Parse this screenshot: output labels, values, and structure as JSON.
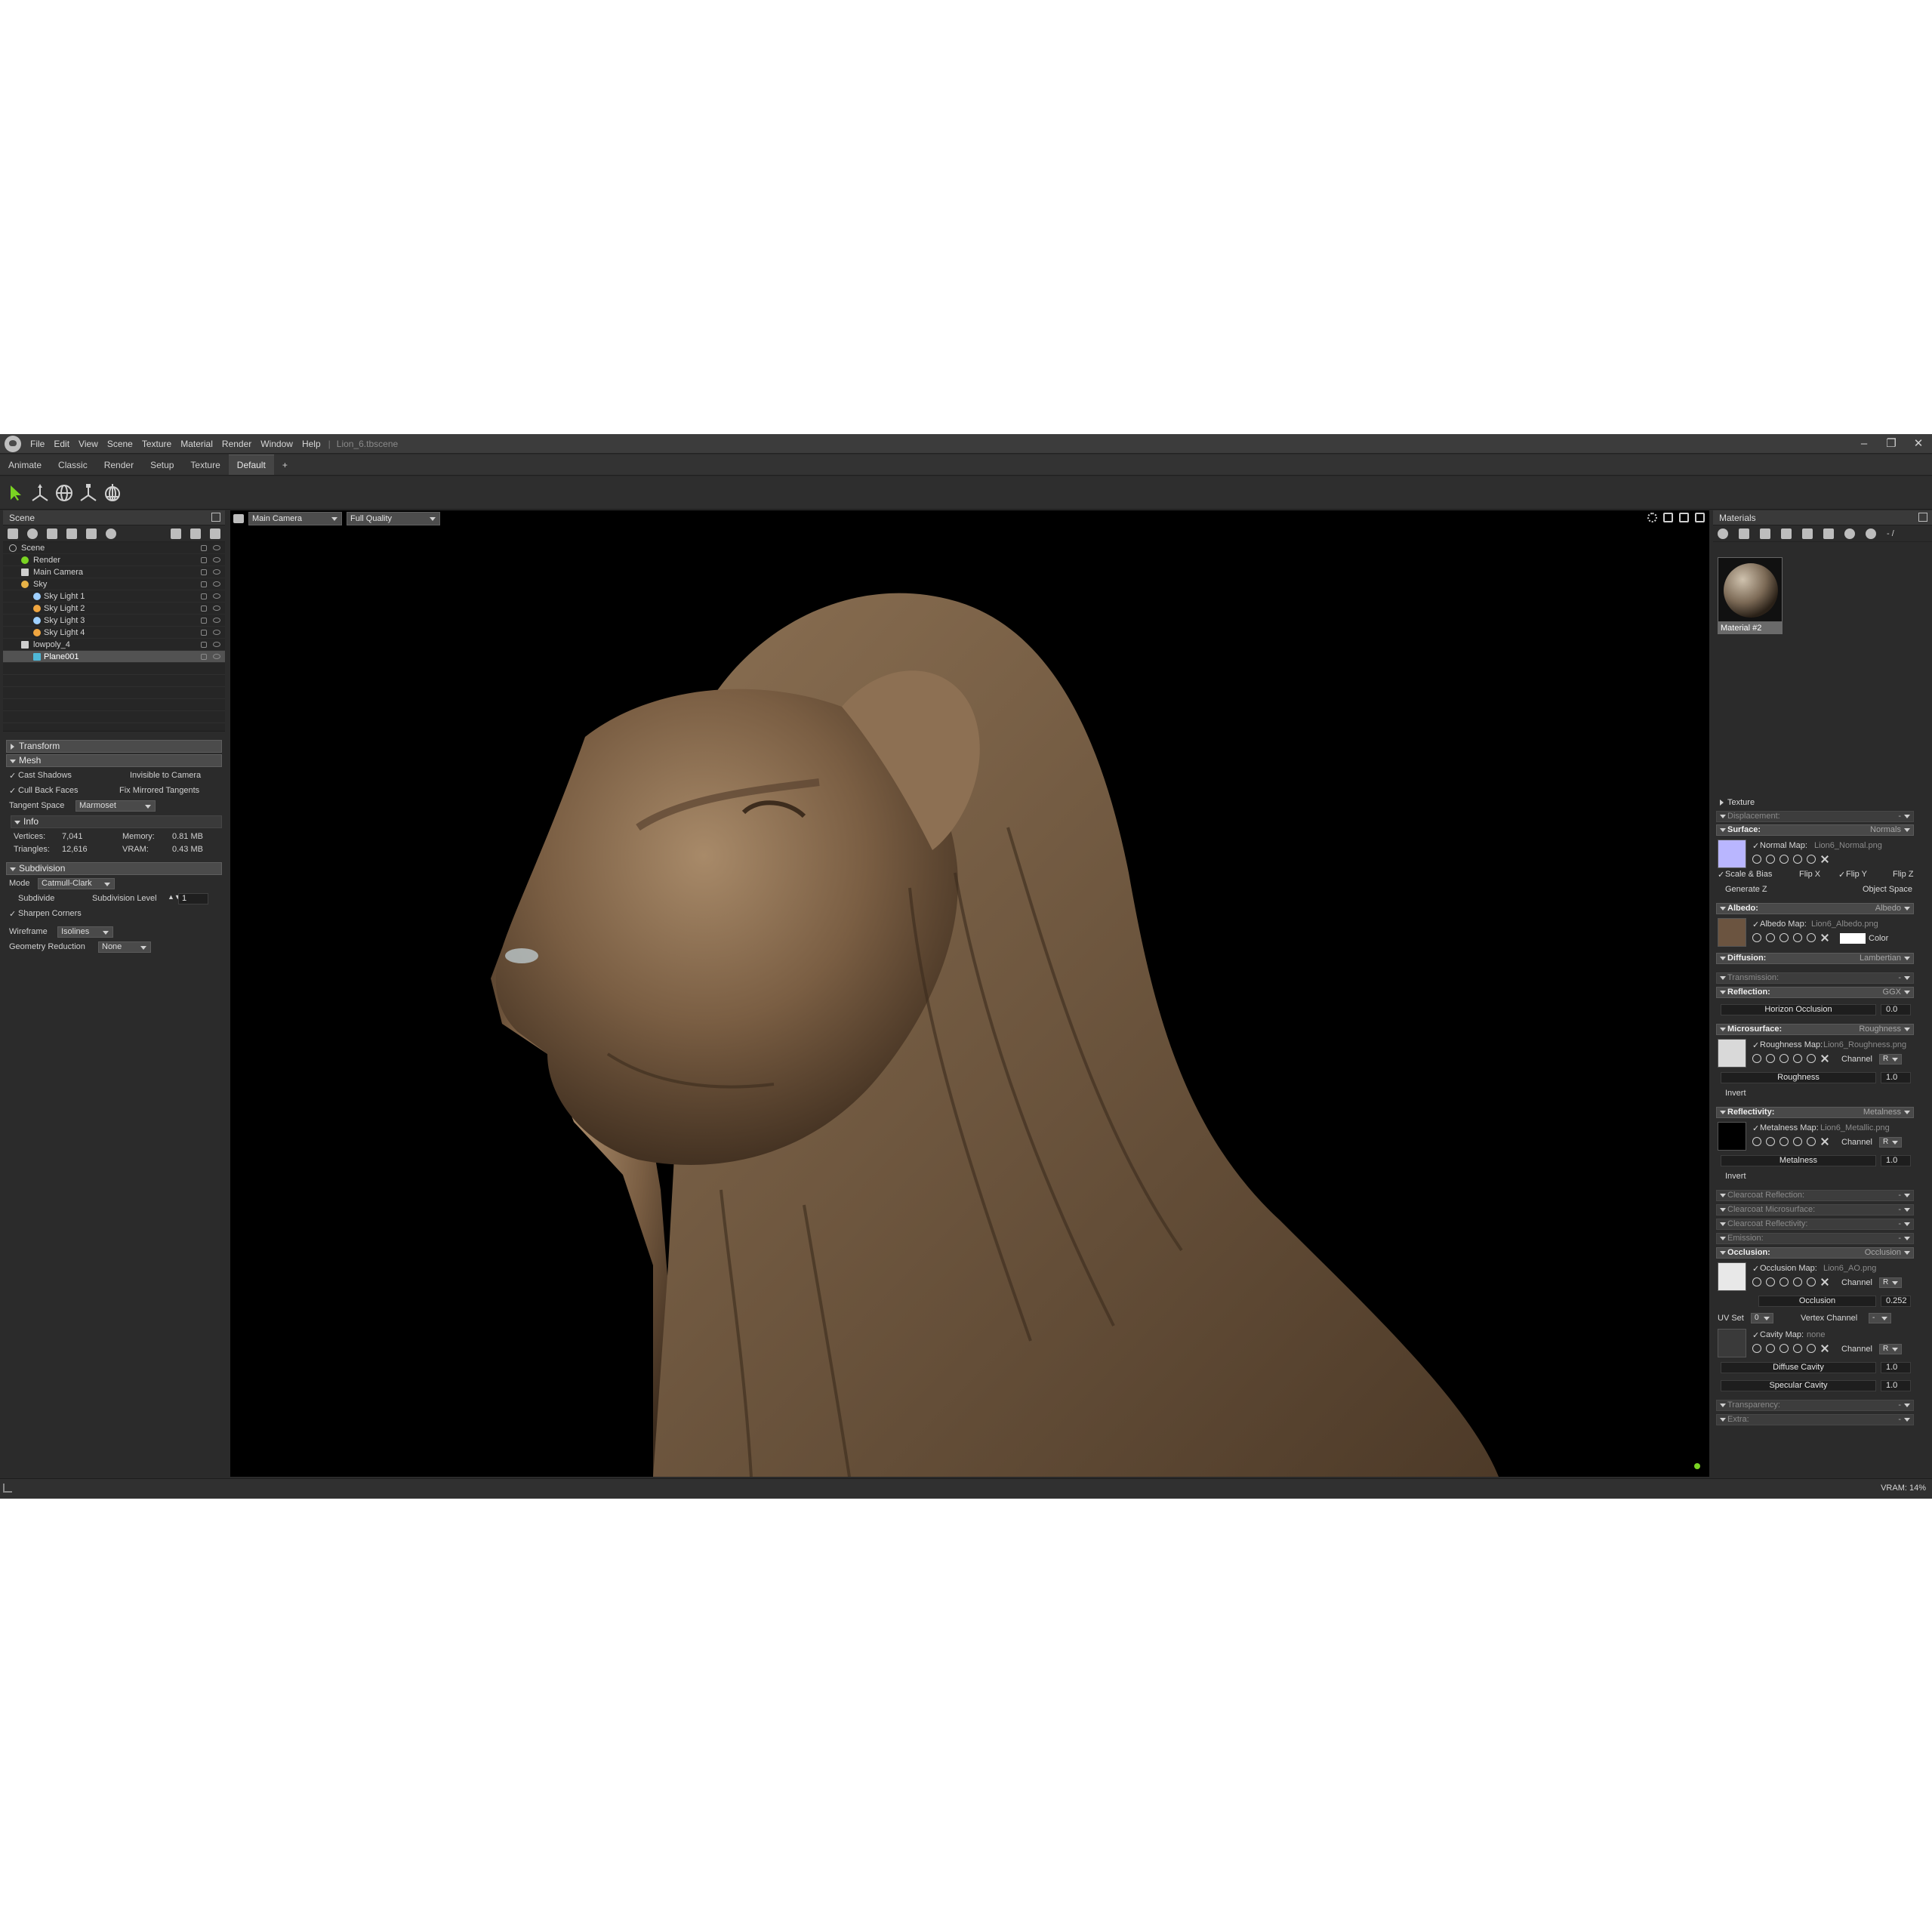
{
  "menu": {
    "items": [
      "File",
      "Edit",
      "View",
      "Scene",
      "Texture",
      "Material",
      "Render",
      "Window",
      "Help"
    ],
    "separator": "|",
    "document": "Lion_6.tbscene"
  },
  "workspace_tabs": [
    "Animate",
    "Classic",
    "Render",
    "Setup",
    "Texture",
    "Default",
    "+"
  ],
  "active_tab": "Default",
  "scene_panel": {
    "title": "Scene",
    "tree": [
      {
        "label": "Scene",
        "indent": 0
      },
      {
        "label": "Render",
        "indent": 1
      },
      {
        "label": "Main Camera",
        "indent": 1
      },
      {
        "label": "Sky",
        "indent": 1
      },
      {
        "label": "Sky Light 1",
        "indent": 2
      },
      {
        "label": "Sky Light 2",
        "indent": 2
      },
      {
        "label": "Sky Light 3",
        "indent": 2
      },
      {
        "label": "Sky Light 4",
        "indent": 2
      },
      {
        "label": "lowpoly_4",
        "indent": 1
      },
      {
        "label": "Plane001",
        "indent": 2
      }
    ],
    "selected": "Plane001"
  },
  "properties": {
    "transform": "Transform",
    "mesh": "Mesh",
    "cast_shadows": "Cast Shadows",
    "invisible_to_camera": "Invisible to Camera",
    "cull_back_faces": "Cull Back Faces",
    "fix_mirrored_tangents": "Fix Mirrored Tangents",
    "tangent_space_label": "Tangent Space",
    "tangent_space_value": "Marmoset",
    "info": "Info",
    "vertices_label": "Vertices:",
    "vertices_value": "7,041",
    "memory_label": "Memory:",
    "memory_value": "0.81 MB",
    "triangles_label": "Triangles:",
    "triangles_value": "12,616",
    "vram_label": "VRAM:",
    "vram_value": "0.43 MB",
    "subdivision": "Subdivision",
    "mode_label": "Mode",
    "mode_value": "Catmull-Clark",
    "subdivide": "Subdivide",
    "subdivision_level_label": "Subdivision Level",
    "subdivision_level_value": "1",
    "sharpen_corners": "Sharpen Corners",
    "wireframe_label": "Wireframe",
    "wireframe_value": "Isolines",
    "geometry_reduction_label": "Geometry Reduction",
    "geometry_reduction_value": "None"
  },
  "viewport": {
    "camera": "Main Camera",
    "quality": "Full Quality"
  },
  "materials": {
    "title": "Materials",
    "page": "- /",
    "material_name": "Material #2",
    "texture": "Texture",
    "displacement": "Displacement:",
    "surface": "Surface:",
    "surface_mode": "Normals",
    "normal_map_label": "Normal Map:",
    "normal_map_file": "Lion6_Normal.png",
    "scale_bias": "Scale & Bias",
    "flip_x": "Flip X",
    "flip_y": "Flip Y",
    "flip_z": "Flip Z",
    "generate_z": "Generate Z",
    "object_space": "Object Space",
    "albedo": "Albedo:",
    "albedo_mode": "Albedo",
    "albedo_map_label": "Albedo Map:",
    "albedo_map_file": "Lion6_Albedo.png",
    "color": "Color",
    "diffusion": "Diffusion:",
    "diffusion_mode": "Lambertian",
    "transmission": "Transmission:",
    "reflection": "Reflection:",
    "reflection_mode": "GGX",
    "horizon_occlusion": "Horizon Occlusion",
    "horizon_occlusion_value": "0.0",
    "microsurface": "Microsurface:",
    "microsurface_mode": "Roughness",
    "roughness_map_label": "Roughness Map:",
    "roughness_map_file": "Lion6_Roughness.png",
    "channel": "Channel",
    "channel_value": "R",
    "roughness": "Roughness",
    "roughness_value": "1.0",
    "invert": "Invert",
    "reflectivity": "Reflectivity:",
    "reflectivity_mode": "Metalness",
    "metalness_map_label": "Metalness Map:",
    "metalness_map_file": "Lion6_Metallic.png",
    "metalness": "Metalness",
    "metalness_value": "1.0",
    "clearcoat_reflection": "Clearcoat Reflection:",
    "clearcoat_microsurface": "Clearcoat Microsurface:",
    "clearcoat_reflectivity": "Clearcoat Reflectivity:",
    "emission": "Emission:",
    "occlusion": "Occlusion:",
    "occlusion_mode": "Occlusion",
    "occlusion_map_label": "Occlusion Map:",
    "occlusion_map_file": "Lion6_AO.png",
    "occlusion_label": "Occlusion",
    "occlusion_value": "0.252",
    "uv_set": "UV Set",
    "uv_set_value": "0",
    "vertex_channel": "Vertex Channel",
    "vertex_channel_value": "-",
    "cavity_map_label": "Cavity Map:",
    "cavity_map_file": "none",
    "diffuse_cavity": "Diffuse Cavity",
    "diffuse_cavity_value": "1.0",
    "specular_cavity": "Specular Cavity",
    "specular_cavity_value": "1.0",
    "transparency": "Transparency:",
    "extra": "Extra:",
    "dash": "-"
  },
  "status": {
    "vram": "VRAM: 14%"
  },
  "colors": {
    "accent_green": "#7ad322",
    "normal_map_swatch": "#b9b6ff",
    "panel_bg": "#2b2b2b"
  }
}
